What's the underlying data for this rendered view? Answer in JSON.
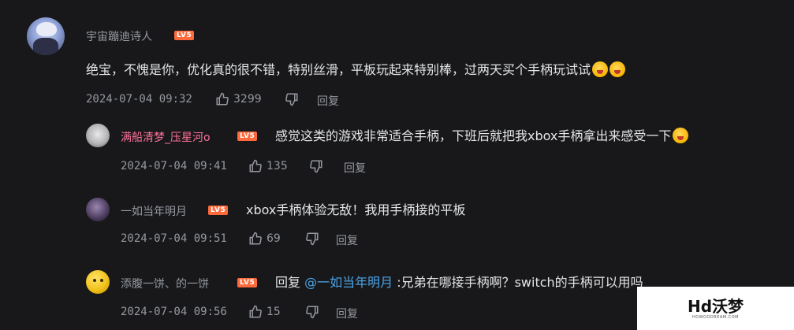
{
  "comments": [
    {
      "username": "宇宙蹦迪诗人",
      "level": "LV5",
      "text": "绝宝，不愧是你，优化真的很不错，特别丝滑，平板玩起来特别棒，过两天买个手柄玩试试",
      "emojis": [
        "wow-face-emoji",
        "wow-face-emoji"
      ],
      "time": "2024-07-04 09:32",
      "likes": "3299",
      "reply_label": "回复"
    }
  ],
  "replies": [
    {
      "username": "满船清梦_压星河o",
      "level": "LV5",
      "text": "感觉这类的游戏非常适合手柄，下班后就把我xbox手柄拿出来感受一下",
      "emojis": [
        "wow-face-emoji"
      ],
      "time": "2024-07-04 09:41",
      "likes": "135",
      "reply_label": "回复"
    },
    {
      "username": "一如当年明月",
      "level": "LV5",
      "text": "xbox手柄体验无敌！我用手柄接的平板",
      "time": "2024-07-04 09:51",
      "likes": "69",
      "reply_label": "回复"
    },
    {
      "username": "添腹一饼、的一饼",
      "level": "LV5",
      "reply_prefix": "回复 ",
      "mention": "@一如当年明月",
      "text": " :兄弟在哪接手柄啊？switch的手柄可以用吗",
      "time": "2024-07-04 09:56",
      "likes": "15",
      "reply_label": "回复"
    }
  ],
  "watermark": {
    "brand": "Hd沃梦",
    "sub": "HDWOODREAM.COM"
  },
  "colors": {
    "background": "#18181a",
    "pink_name": "#fb7299",
    "level_badge": "#ff6a3d",
    "mention": "#4aa4e8",
    "meta": "#9499a0"
  }
}
